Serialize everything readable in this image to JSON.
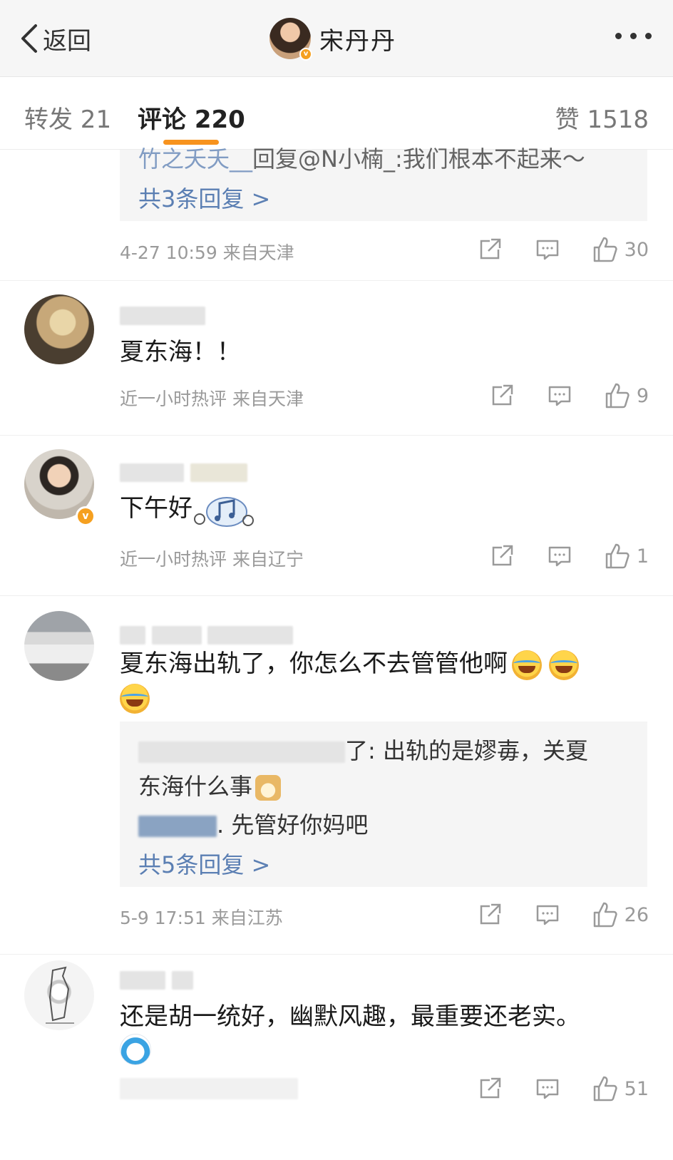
{
  "header": {
    "back_label": "返回",
    "title": "宋丹丹",
    "avatar_badge": "v"
  },
  "tabs": {
    "repost": "转发 21",
    "comment": "评论 220",
    "like": "赞 1518"
  },
  "thread0": {
    "reply_user": "竹之夭夭__",
    "reply_text": "回复@N小楠_:我们根本不起来～",
    "more_replies": "共3条回复 >",
    "meta": "4-27 10:59  来自天津",
    "likes": "30"
  },
  "comments": [
    {
      "text": "夏东海！！",
      "meta": "近一小时热评  来自天津",
      "likes": "9"
    },
    {
      "text": "下午好",
      "meta": "近一小时热评  来自辽宁",
      "likes": "1",
      "avatar_badge": "v"
    },
    {
      "text": "夏东海出轨了，你怎么不去管管他啊",
      "reply1_tail": "了: 出轨的是嫪毐，关夏",
      "reply1_line2": "东海什么事",
      "reply2_tail": ". 先管好你妈吧",
      "more_replies": "共5条回复 >",
      "meta": "5-9 17:51  来自江苏",
      "likes": "26"
    },
    {
      "text": "还是胡一统好，幽默风趣，最重要还老实。",
      "likes": "51"
    }
  ],
  "icons": {
    "back": "chevron-left-icon",
    "more": "more-dots-icon",
    "share": "share-icon",
    "comment": "comment-icon",
    "like": "thumbs-up-icon"
  },
  "colors": {
    "accent": "#f7931e",
    "link": "#5b7fb3",
    "meta": "#9a9a9a"
  }
}
